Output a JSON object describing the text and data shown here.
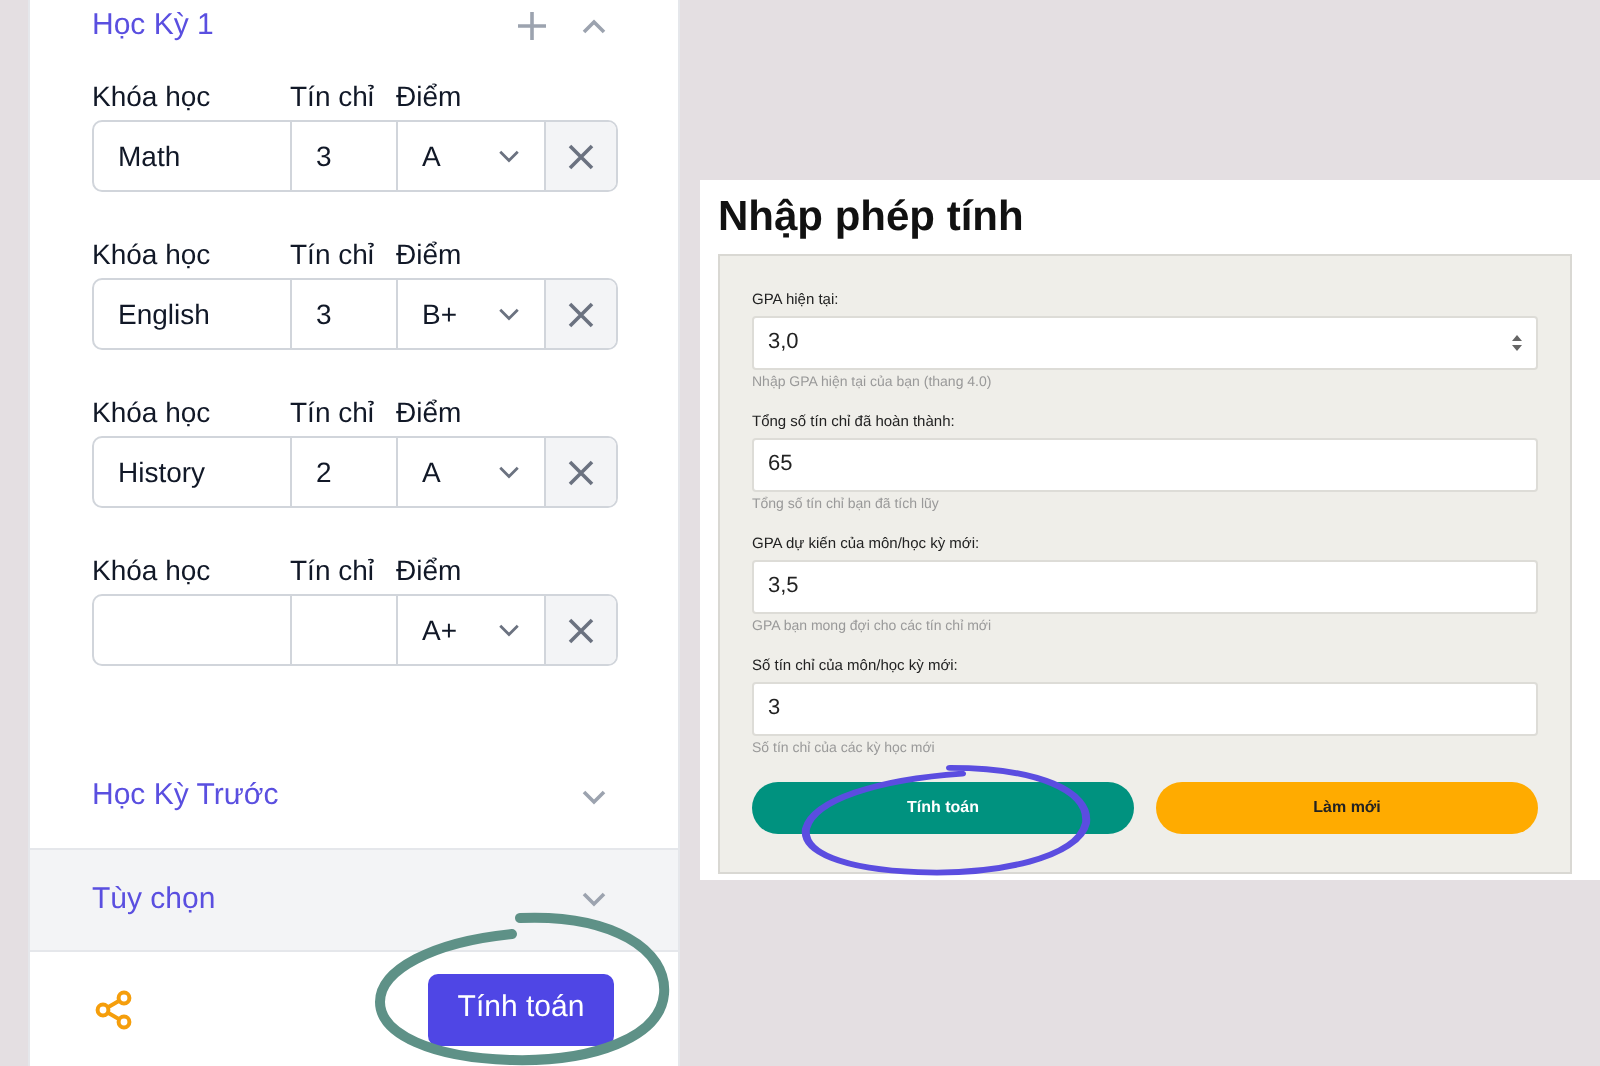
{
  "gpa_panel": {
    "semester": {
      "title": "Học Kỳ 1",
      "expanded": true,
      "courses": [
        {
          "course_label": "Khóa học",
          "credit_label": "Tín chỉ",
          "grade_label": "Điểm",
          "course": "Math",
          "credits": "3",
          "grade": "A"
        },
        {
          "course_label": "Khóa học",
          "credit_label": "Tín chỉ",
          "grade_label": "Điểm",
          "course": "English",
          "credits": "3",
          "grade": "B+"
        },
        {
          "course_label": "Khóa học",
          "credit_label": "Tín chỉ",
          "grade_label": "Điểm",
          "course": "History",
          "credits": "2",
          "grade": "A"
        },
        {
          "course_label": "Khóa học",
          "credit_label": "Tín chỉ",
          "grade_label": "Điểm",
          "grade": "A+"
        }
      ]
    },
    "sections": [
      {
        "title": "Học Kỳ Trước",
        "expanded": false,
        "highlighted": false
      },
      {
        "title": "Tùy chọn",
        "expanded": false,
        "highlighted": true
      }
    ],
    "button": "Tính toán"
  },
  "calculator": {
    "title": "Nhập phép tính",
    "fields": [
      {
        "kind": "spinner",
        "label": "GPA hiện tại:",
        "value": "3,0",
        "hint": "Nhập GPA hiện tại của bạn (thang 4.0)"
      },
      {
        "kind": "text",
        "label": "Tổng số tín chỉ đã hoàn thành:",
        "value": "65",
        "hint": "Tổng số tín chỉ bạn đã tích lũy"
      },
      {
        "kind": "text",
        "label": "GPA dự kiến của môn/học kỳ mới:",
        "value": "3,5",
        "hint": "GPA bạn mong đợi cho các tín chỉ mới"
      },
      {
        "kind": "text",
        "label": "Số tín chỉ của môn/học kỳ mới:",
        "value": "3",
        "hint": "Số tín chỉ của các kỳ học mới"
      }
    ],
    "buttons": [
      {
        "kind": "primary",
        "label": "Tính toán"
      },
      {
        "kind": "secondary",
        "label": "Làm mới"
      }
    ]
  }
}
